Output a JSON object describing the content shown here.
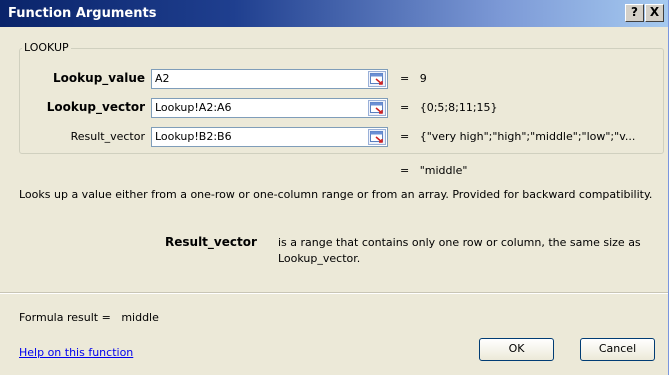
{
  "window": {
    "title": "Function Arguments",
    "help_glyph": "?",
    "close_glyph": "X"
  },
  "group": {
    "legend": "LOOKUP"
  },
  "arguments": [
    {
      "label": "Lookup_value",
      "bold": true,
      "value": "A2",
      "equals": "=",
      "result": "9"
    },
    {
      "label": "Lookup_vector",
      "bold": true,
      "value": "Lookup!A2:A6",
      "equals": "=",
      "result": "{0;5;8;11;15}"
    },
    {
      "label": "Result_vector",
      "bold": false,
      "value": "Lookup!B2:B6",
      "equals": "=",
      "result": "{\"very high\";\"high\";\"middle\";\"low\";\"v..."
    }
  ],
  "overall_result": {
    "equals": "=",
    "value": "\"middle\""
  },
  "description": "Looks up a value either from a one-row or one-column range or from an array. Provided for backward compatibility.",
  "parameter_help": {
    "name": "Result_vector",
    "text": "is a range that contains only one row or column, the same size as Lookup_vector."
  },
  "formula_result": {
    "label": "Formula result =",
    "value": "middle"
  },
  "help_link": "Help on this function",
  "buttons": {
    "ok": "OK",
    "cancel": "Cancel"
  },
  "icons": {
    "ref_button": "collapse-dialog-icon"
  }
}
